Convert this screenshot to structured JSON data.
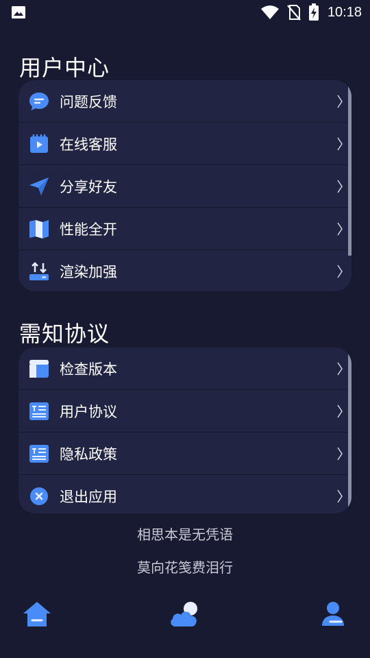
{
  "status_bar": {
    "time": "10:18",
    "icons": [
      "image-icon",
      "wifi-icon",
      "no-sim-icon",
      "battery-charging-icon"
    ]
  },
  "sections": [
    {
      "title": "用户中心",
      "items": [
        {
          "label": "问题反馈",
          "icon": "feedback-chat-icon"
        },
        {
          "label": "在线客服",
          "icon": "video-service-icon"
        },
        {
          "label": "分享好友",
          "icon": "send-paper-plane-icon"
        },
        {
          "label": "性能全开",
          "icon": "map-icon"
        },
        {
          "label": "渲染加强",
          "icon": "sort-arrows-icon"
        }
      ]
    },
    {
      "title": "需知协议",
      "items": [
        {
          "label": "检查版本",
          "icon": "layout-panel-icon"
        },
        {
          "label": "用户协议",
          "icon": "text-document-icon"
        },
        {
          "label": "隐私政策",
          "icon": "text-document-icon"
        },
        {
          "label": "退出应用",
          "icon": "close-circle-icon"
        }
      ]
    }
  ],
  "chevron": "〉",
  "footer": {
    "line1": "相思本是无凭语",
    "line2": "莫向花笺费泪行"
  },
  "bottom_nav": [
    "home-icon",
    "weather-cloud-icon",
    "user-profile-icon"
  ],
  "colors": {
    "background": "#171a30",
    "card": "#212442",
    "accent": "#4a8cf7"
  }
}
